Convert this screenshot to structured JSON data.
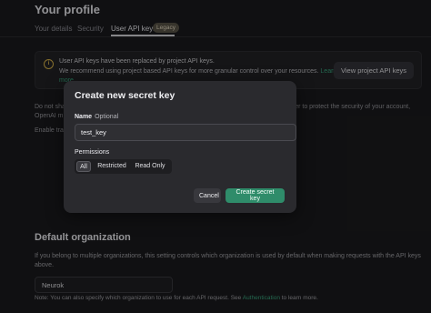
{
  "page": {
    "title": "Your profile"
  },
  "tabs": [
    {
      "label": "Your details"
    },
    {
      "label": "Security"
    },
    {
      "label": "User API keys",
      "badge": "Legacy"
    }
  ],
  "notice": {
    "title": "User API keys have been replaced by project API keys.",
    "body": "We recommend using project based API keys for more granular control over your resources.",
    "link": "Learn more",
    "button": "View project API keys",
    "icon": "info-icon"
  },
  "background_text": {
    "line1_left": "Do not sha",
    "line1_right": "rder to protect the security of your account,",
    "line2": "OpenAI m",
    "line3": "Enable tra"
  },
  "modal": {
    "title": "Create new secret key",
    "name_label": "Name",
    "name_optional": "Optional",
    "name_value": "test_key",
    "permissions_label": "Permissions",
    "permissions": [
      "All",
      "Restricted",
      "Read Only"
    ],
    "selected_permission": "All",
    "cancel": "Cancel",
    "create": "Create secret key"
  },
  "default_org": {
    "title": "Default organization",
    "description": "If you belong to multiple organizations, this setting controls which organization is used by default when making requests with the API keys above.",
    "selected": "Neurok",
    "note_prefix": "Note: You can also specify which organization to use for each API request. See ",
    "note_link": "Authentication",
    "note_suffix": " to learn more."
  },
  "colors": {
    "accent": "#2f8c6a",
    "link": "#3aa981",
    "warning": "#d9b44a",
    "background": "#1b1b1d",
    "modal": "#2a2a2e"
  }
}
